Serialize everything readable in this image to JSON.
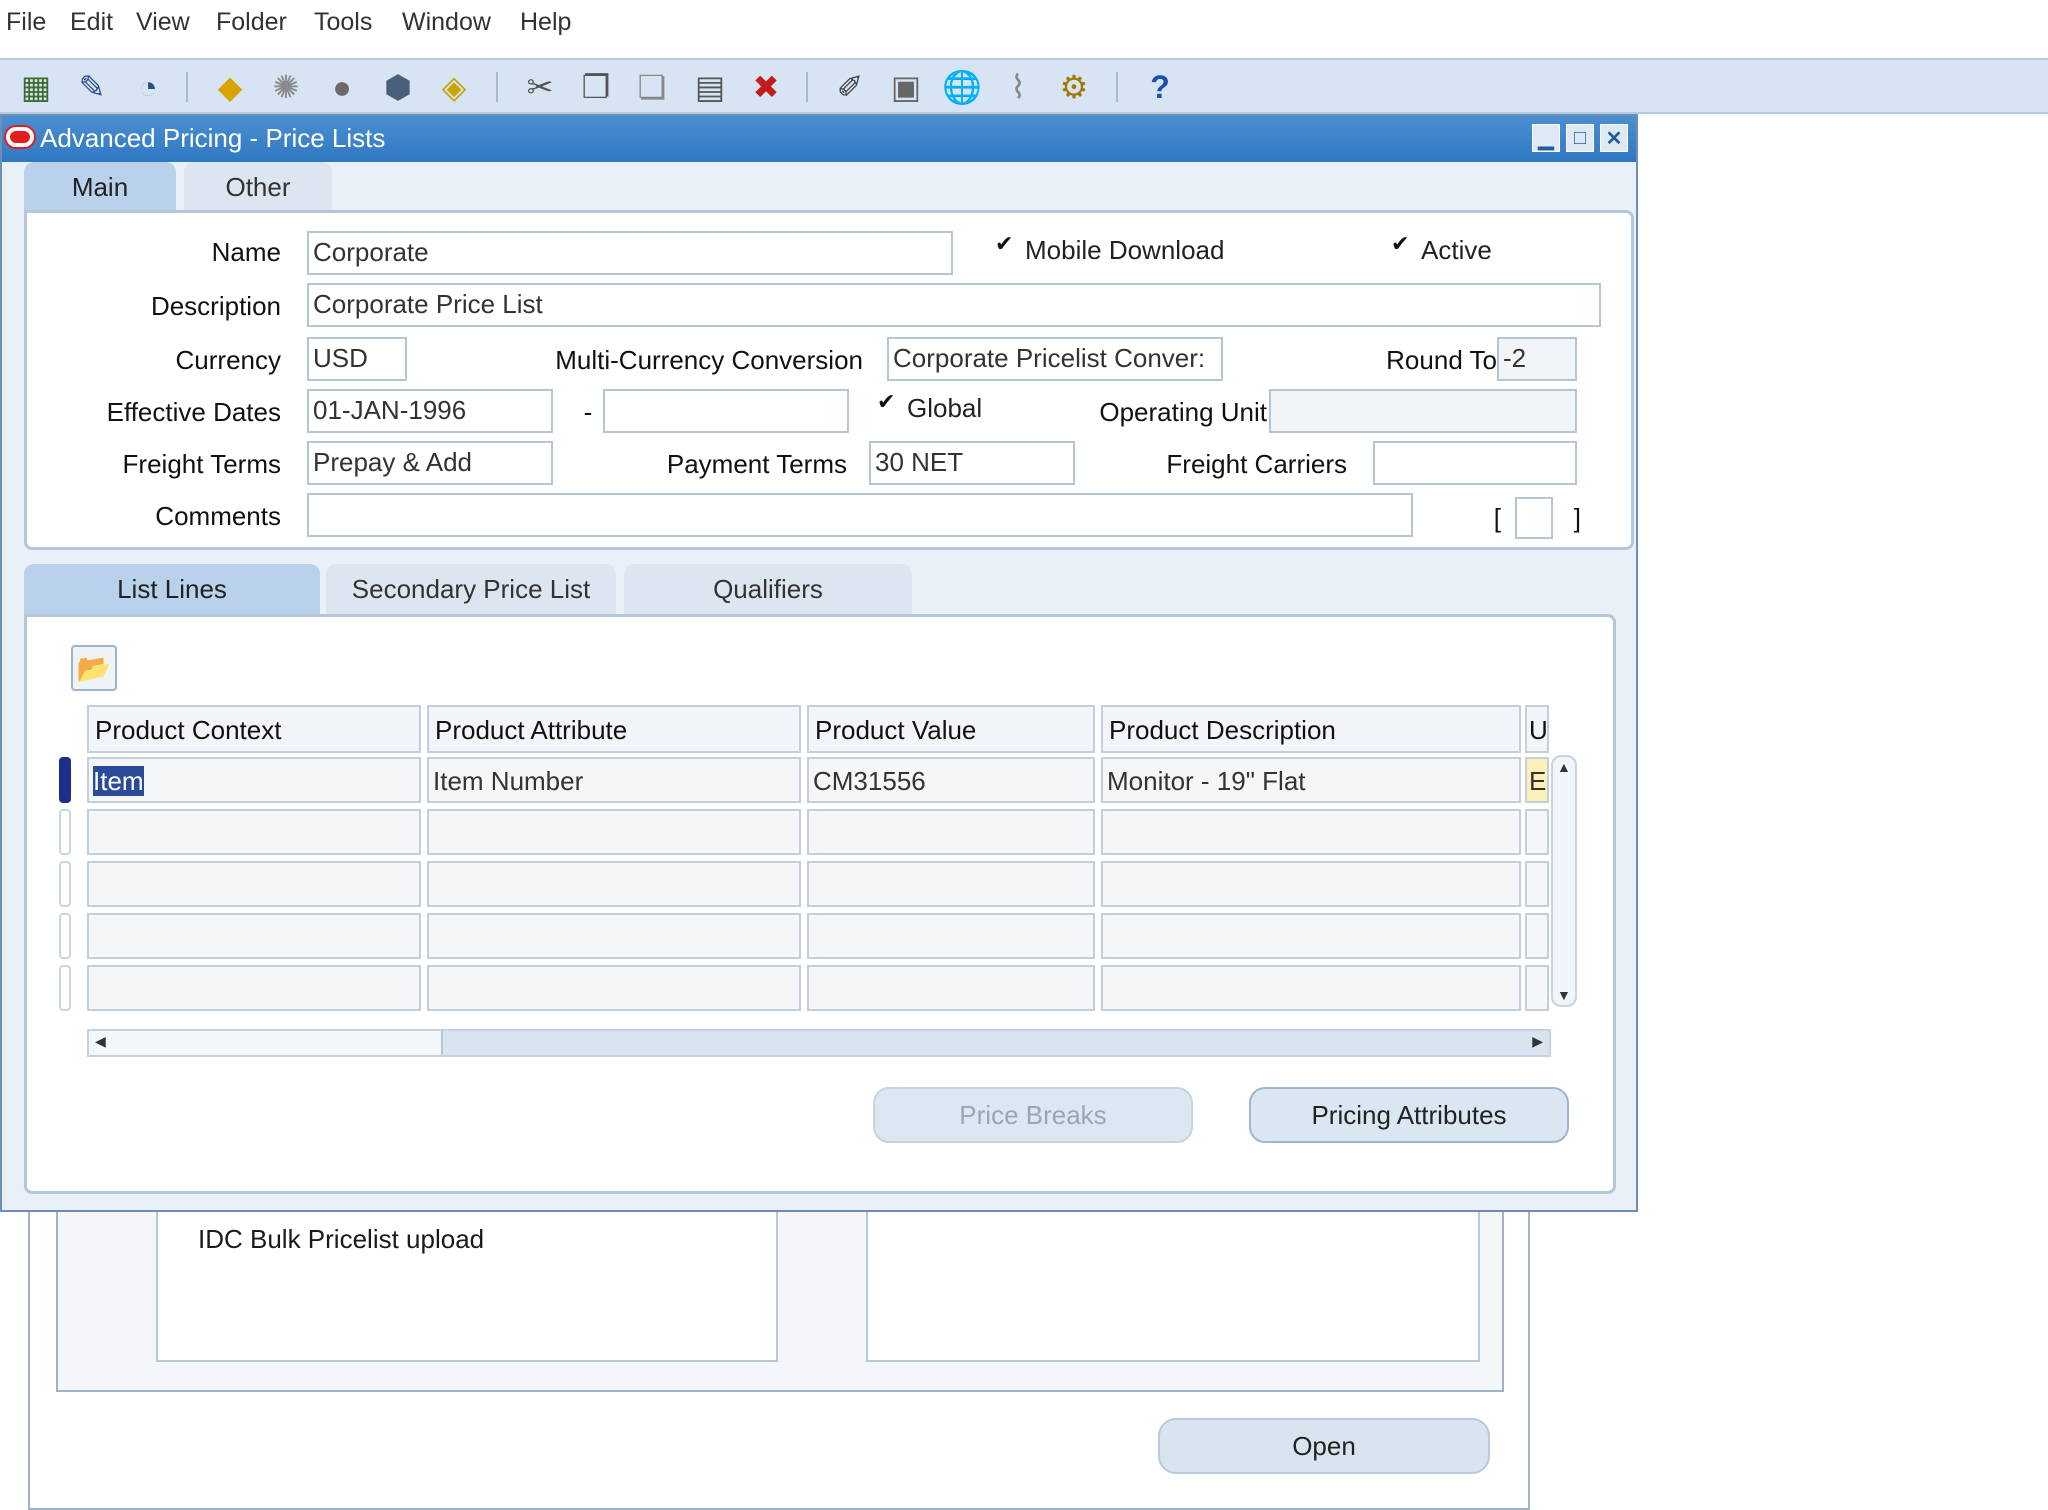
{
  "menu": [
    "File",
    "Edit",
    "View",
    "Folder",
    "Tools",
    "Window",
    "Help"
  ],
  "toolbar_icons": [
    "new-icon",
    "find-icon",
    "navigator-icon",
    "save-icon",
    "switch-responsibility-icon",
    "print-icon",
    "close-form-icon",
    "place-on-navigator-icon",
    "cut-icon",
    "copy-icon",
    "paste-icon",
    "clear-record-icon",
    "delete-record-icon",
    "edit-field-icon",
    "zoom-icon",
    "translations-icon",
    "attachments-icon",
    "folder-tools-icon",
    "help-icon"
  ],
  "help_glyph": "?",
  "window": {
    "title": "Advanced Pricing - Price Lists",
    "controls": {
      "minimize": "▁",
      "maximize": "□",
      "close": "✕"
    }
  },
  "header_tabs": [
    "Main",
    "Other"
  ],
  "form": {
    "name_label": "Name",
    "name_value": "Corporate",
    "mobile_download_label": "Mobile Download",
    "mobile_download_checked": true,
    "active_label": "Active",
    "active_checked": true,
    "description_label": "Description",
    "description_value": "Corporate Price List",
    "currency_label": "Currency",
    "currency_value": "USD",
    "multicurrency_label": "Multi-Currency Conversion",
    "multicurrency_value": "Corporate Pricelist Conver:",
    "round_to_label": "Round To",
    "round_to_value": "-2",
    "effective_dates_label": "Effective Dates",
    "effective_from": "01-JAN-1996",
    "date_separator": "-",
    "effective_to": "",
    "global_label": "Global",
    "global_checked": true,
    "operating_unit_label": "Operating Unit",
    "operating_unit_value": "",
    "freight_terms_label": "Freight Terms",
    "freight_terms_value": "Prepay & Add",
    "payment_terms_label": "Payment Terms",
    "payment_terms_value": "30 NET",
    "freight_carriers_label": "Freight Carriers",
    "freight_carriers_value": "",
    "comments_label": "Comments",
    "comments_value": "",
    "dff_open": "[",
    "dff_close": "]"
  },
  "lines_tabs": [
    "List Lines",
    "Secondary Price List",
    "Qualifiers"
  ],
  "lines_table": {
    "columns": [
      "Product Context",
      "Product Attribute",
      "Product Value",
      "Product Description",
      "U"
    ],
    "rows": [
      [
        "Item",
        "Item Number",
        "CM31556",
        "Monitor - 19\" Flat",
        "E"
      ],
      [
        "",
        "",
        "",
        "",
        ""
      ],
      [
        "",
        "",
        "",
        "",
        ""
      ],
      [
        "",
        "",
        "",
        "",
        ""
      ],
      [
        "",
        "",
        "",
        "",
        ""
      ]
    ]
  },
  "buttons": {
    "price_breaks": "Price Breaks",
    "pricing_attributes": "Pricing Attributes"
  },
  "background_window": {
    "list_item": "IDC Bulk Pricelist upload",
    "open_button": "Open"
  },
  "colors": {
    "title_bar": "#2f78c2",
    "panel_border": "#b3c6da",
    "toolbar_bg": "#d6e4f3",
    "active_tab": "#b9d1ea",
    "current_row": "#1c2f8c"
  }
}
